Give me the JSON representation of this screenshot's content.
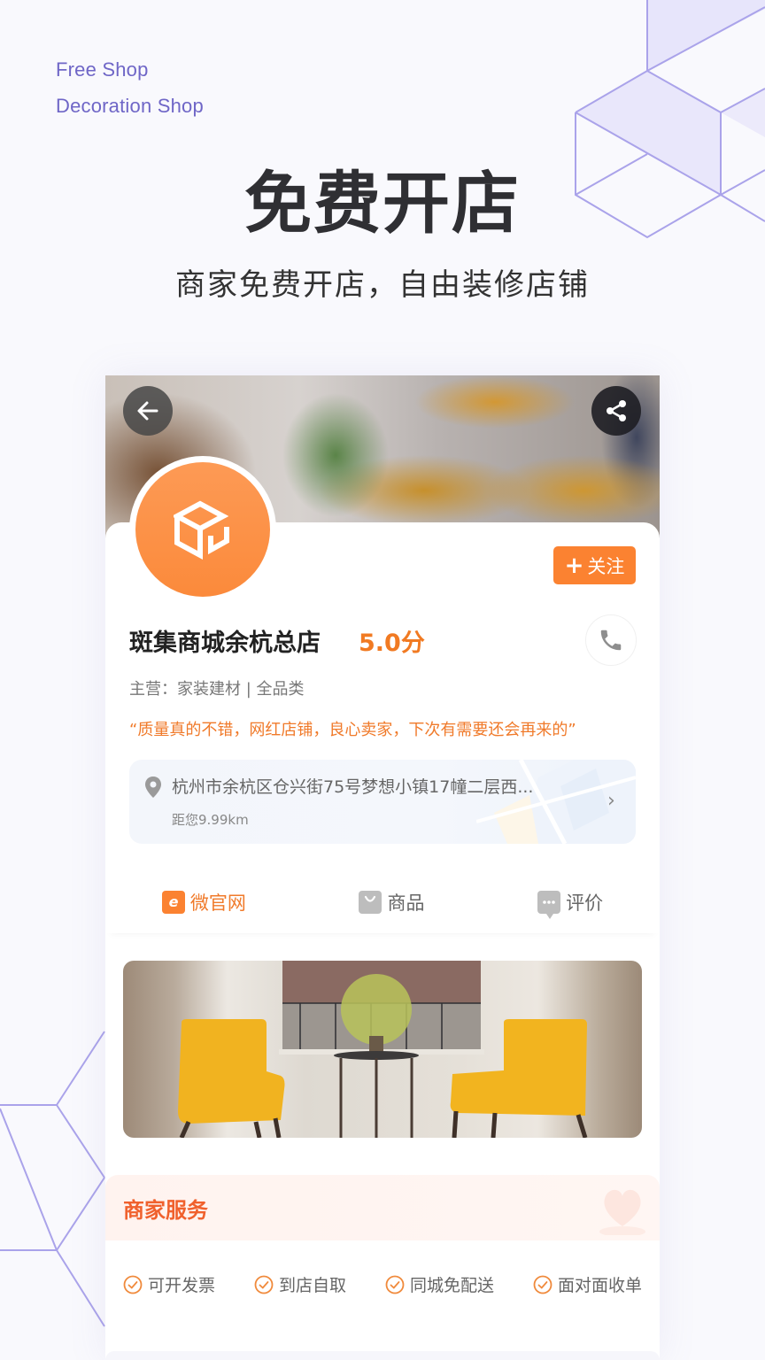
{
  "header": {
    "tag_line_1": "Free Shop",
    "tag_line_2": "Decoration Shop",
    "title": "免费开店",
    "subtitle": "商家免费开店，自由装修店铺"
  },
  "colors": {
    "accent": "#fb8231",
    "accent_text": "#f07a2a",
    "service_title": "#f0612d",
    "decor_purple": "#6f66c7"
  },
  "store": {
    "banner_buttons": {
      "back_icon": "arrow-left-icon",
      "share_icon": "share-icon"
    },
    "avatar_icon": "cube-logo-icon",
    "follow_label": "关注",
    "follow_prefix": "+",
    "name": "斑集商城余杭总店",
    "score": "5.0分",
    "phone_icon": "phone-icon",
    "main_category": "主营：家装建材 | 全品类",
    "quote": "“质量真的不错，网红店铺，良心卖家，下次有需要还会再来的”",
    "address": "杭州市余杭区仓兴街75号梦想小镇17幢二层西...",
    "distance": "距您9.99km"
  },
  "tabs": [
    {
      "label": "微官网",
      "icon": "e-site-icon",
      "active": true
    },
    {
      "label": "商品",
      "icon": "shopping-bag-icon",
      "active": false
    },
    {
      "label": "评价",
      "icon": "comment-icon",
      "active": false
    }
  ],
  "services": {
    "title": "商家服务",
    "items": [
      {
        "label": "可开发票",
        "icon": "check-circle-icon"
      },
      {
        "label": "到店自取",
        "icon": "check-circle-icon"
      },
      {
        "label": "同城免配送",
        "icon": "check-circle-icon"
      },
      {
        "label": "面对面收单",
        "icon": "check-circle-icon"
      }
    ]
  }
}
